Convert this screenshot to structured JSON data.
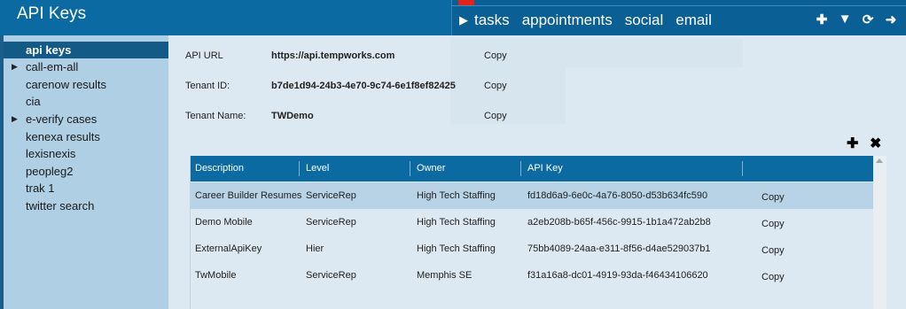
{
  "header": {
    "title": "API Keys",
    "nav": [
      "tasks",
      "appointments",
      "social",
      "email"
    ],
    "icons": [
      "plus-icon",
      "filter-icon",
      "refresh-icon",
      "arrow-right-icon"
    ]
  },
  "sidebar": {
    "items": [
      {
        "label": "api keys",
        "active": true,
        "expandable": false
      },
      {
        "label": "call-em-all",
        "active": false,
        "expandable": true
      },
      {
        "label": "carenow results",
        "active": false,
        "expandable": false
      },
      {
        "label": "cia",
        "active": false,
        "expandable": false
      },
      {
        "label": "e-verify cases",
        "active": false,
        "expandable": true
      },
      {
        "label": "kenexa results",
        "active": false,
        "expandable": false
      },
      {
        "label": "lexisnexis",
        "active": false,
        "expandable": false
      },
      {
        "label": "peopleg2",
        "active": false,
        "expandable": false
      },
      {
        "label": "trak 1",
        "active": false,
        "expandable": false
      },
      {
        "label": "twitter search",
        "active": false,
        "expandable": false
      }
    ]
  },
  "info": {
    "api_url_label": "API URL",
    "api_url_value": "https://api.tempworks.com",
    "tenant_id_label": "Tenant ID:",
    "tenant_id_value": "b7de1d94-24b3-4e70-9c74-6e1f8ef82425",
    "tenant_name_label": "Tenant Name:",
    "tenant_name_value": "TWDemo",
    "copy_label": "Copy"
  },
  "grid": {
    "columns": [
      "Description",
      "Level",
      "Owner",
      "API Key"
    ],
    "copy_label": "Copy",
    "rows": [
      {
        "description": "Career Builder Resumes",
        "level": "ServiceRep",
        "owner": "High Tech Staffing",
        "api_key": "fd18d6a9-6e0c-4a76-8050-d53b634fc590",
        "selected": true
      },
      {
        "description": "Demo Mobile",
        "level": "ServiceRep",
        "owner": "High Tech Staffing",
        "api_key": "a2eb208b-b65f-456c-9915-1b1a472ab2b8",
        "selected": false
      },
      {
        "description": "ExternalApiKey",
        "level": "Hier",
        "owner": "High Tech Staffing",
        "api_key": "75bb4089-24aa-e311-8f56-d4ae529037b1",
        "selected": false
      },
      {
        "description": "TwMobile",
        "level": "ServiceRep",
        "owner": "Memphis SE",
        "api_key": "f31a16a8-dc01-4919-93da-f46434106620",
        "selected": false
      }
    ]
  },
  "colors": {
    "header": "#0b6aa2",
    "sidebar": "#aecfe4",
    "selected_row": "#b7d3e5",
    "background": "#dce9f2"
  }
}
